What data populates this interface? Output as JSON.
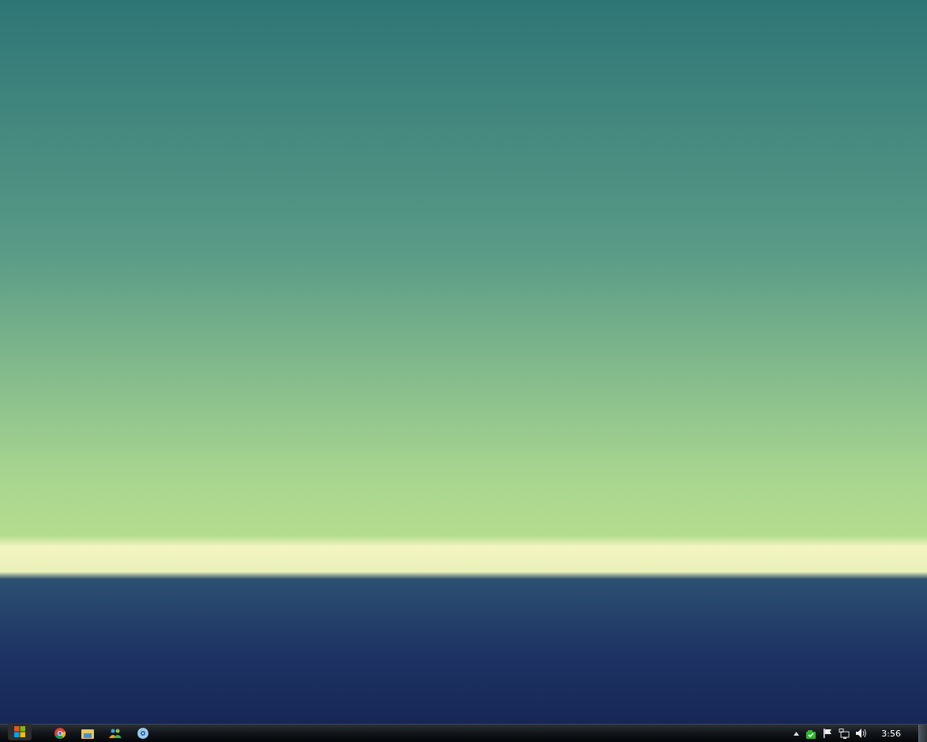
{
  "taskbar": {
    "clock": "3:56"
  }
}
